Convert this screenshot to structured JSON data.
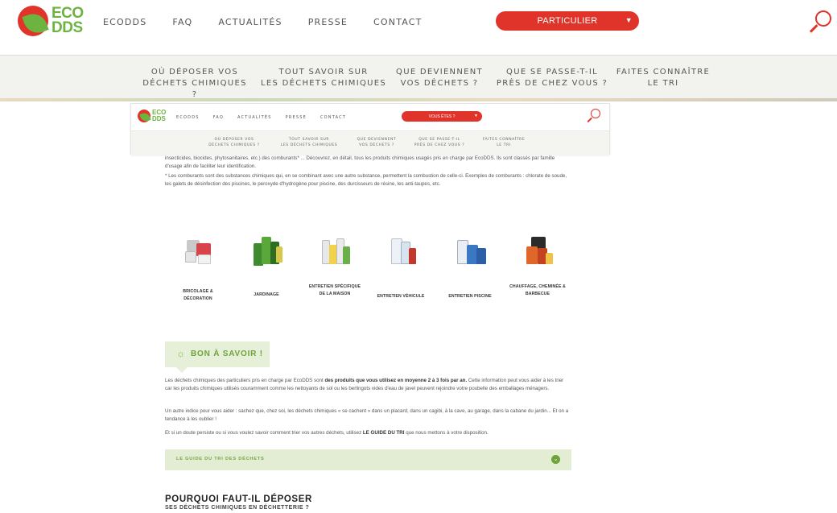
{
  "brand": {
    "logo_top": "ECO",
    "logo_bottom": "DDS"
  },
  "header": {
    "nav": [
      "ECODDS",
      "FAQ",
      "ACTUALITÉS",
      "PRESSE",
      "CONTACT"
    ],
    "dropdown_label": "PARTICULIER"
  },
  "subnav": [
    {
      "line1": "OÙ DÉPOSER VOS",
      "line2": "DÉCHETS CHIMIQUES ?"
    },
    {
      "line1": "TOUT SAVOIR SUR",
      "line2": "LES DÉCHETS CHIMIQUES"
    },
    {
      "line1": "QUE DEVIENNENT",
      "line2": "VOS DÉCHETS ?"
    },
    {
      "line1": "QUE SE PASSE-T-IL",
      "line2": "PRÈS DE CHEZ VOUS ?"
    },
    {
      "line1": "FAITES CONNAÎTRE",
      "line2": "LE TRI"
    }
  ],
  "small_header": {
    "nav": [
      "ECODDS",
      "FAQ",
      "ACTUALITÉS",
      "PRESSE",
      "CONTACT"
    ],
    "dropdown_label": "VOUS ÊTES ?",
    "subnav": [
      {
        "line1": "OÙ DÉPOSER VOS",
        "line2": "DÉCHETS CHIMIQUES ?"
      },
      {
        "line1": "TOUT SAVOIR SUR",
        "line2": "LES DÉCHETS CHIMIQUES"
      },
      {
        "line1": "QUE DEVIENNENT",
        "line2": "VOS DÉCHETS ?"
      },
      {
        "line1": "QUE SE PASSE-T-IL",
        "line2": "PRÈS DE CHEZ VOUS ?"
      },
      {
        "line1": "FAITES CONNAÎTRE",
        "line2": "LE TRI"
      }
    ]
  },
  "content": {
    "intro_partial": "insecticides, biocides, phytosanitaires, etc.) des comburants* ... Découvrez, en détail, tous les produits chimiques usagés pris en charge par EcoDDS. Ils sont classés par famille d'usage afin de faciliter leur identification.",
    "comburants_note": "* Les comburants sont des substances chimiques qui, en se combinant avec une autre substance, permettent la combustion de celle-ci. Exemples de comburants : chlorate de soude, les galets de désinfection des piscines, le peroxyde d'hydrogène pour piscine, des durcisseurs de résine, les anti-taupes, etc.",
    "categories": [
      {
        "label": "BRICOLAGE & DÉCORATION",
        "icon": "paint-cans-icon"
      },
      {
        "label": "JARDINAGE",
        "icon": "garden-bottles-icon"
      },
      {
        "label": "ENTRETIEN SPÉCIFIQUE DE LA MAISON",
        "icon": "home-products-icon"
      },
      {
        "label": "ENTRETIEN VÉHICULE",
        "icon": "car-products-icon"
      },
      {
        "label": "ENTRETIEN PISCINE",
        "icon": "pool-products-icon"
      },
      {
        "label": "CHAUFFAGE, CHEMINÉE & BARBECUE",
        "icon": "heating-products-icon"
      }
    ],
    "bon_savoir_title": "BON À SAVOIR !",
    "p1_start": "Les déchets chimiques des particuliers pris en charge par EcoDDS sont ",
    "p1_bold": "des produits que vous utilisez en moyenne 2 à 3 fois par an.",
    "p1_end": " Cette information peut vous aider à les trier car les produits chimiques utilisés couramment comme les nettoyants de sol ou les berlingots vides d'eau de javel peuvent rejoindre votre poubelle des emballages ménagers.",
    "p2": "Un autre indice pour vous aider : sachez que, chez soi, les déchets chimiques « se cachent » dans un placard, dans un cagibi, à la cave, au garage, dans la cabane du jardin... Et on a tendance à les oublier !",
    "p3_start": "Et si un doute persiste ou si vous voulez savoir comment trier vos autres déchets, utilisez ",
    "p3_bold": "LE GUIDE DU TRI",
    "p3_end": " que nous mettons à votre disposition.",
    "guide_label": "LE GUIDE DU TRI DES DÉCHETS",
    "pourquoi_title": "POURQUOI FAUT-IL DÉPOSER",
    "pourquoi_sub": "SES DÉCHETS CHIMIQUES EN DÉCHETTERIE ?"
  },
  "colors": {
    "brand_red": "#e0342b",
    "brand_green": "#6cb33f",
    "soft_green": "#e2edd4"
  }
}
